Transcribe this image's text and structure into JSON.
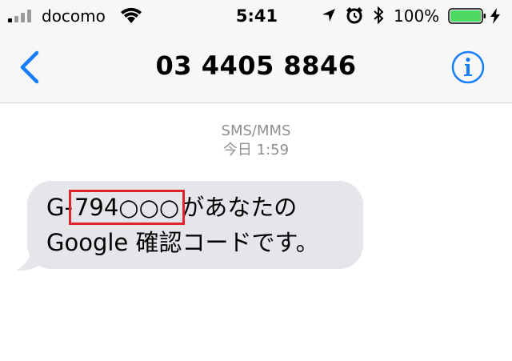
{
  "status_bar": {
    "carrier": "docomo",
    "time": "5:41",
    "battery_percent": "100%",
    "battery_level": 1.0,
    "battery_color": "#4cd964",
    "icons": [
      "signal-icon",
      "wifi-icon",
      "location-icon",
      "alarm-icon",
      "bluetooth-icon",
      "battery-icon",
      "charging-icon"
    ]
  },
  "nav": {
    "title": "03 4405 8846",
    "accent_color": "#157efb",
    "back_icon": "chevron-left-icon",
    "info_icon": "info-icon"
  },
  "thread": {
    "service": "SMS/MMS",
    "timestamp": "今日 1:59"
  },
  "message": {
    "prefix": "G-",
    "code": "794○○○",
    "line1_suffix": "があなたの",
    "line2": "Google 確認コードです。",
    "bubble_color": "#e5e5ea",
    "highlight_color": "#e0242c"
  }
}
